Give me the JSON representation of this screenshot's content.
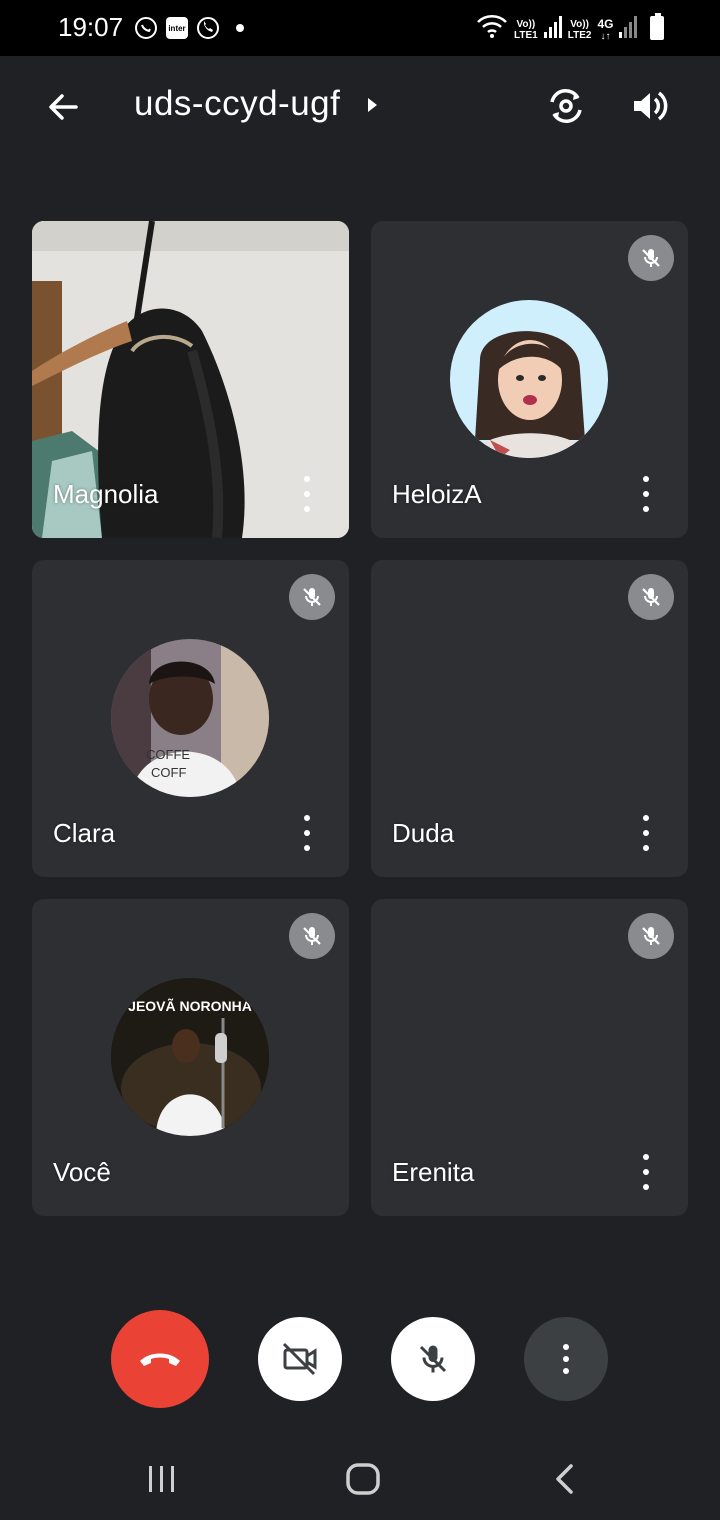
{
  "status_bar": {
    "time": "19:07",
    "notifications": [
      "whatsapp-icon",
      "inter-app-icon",
      "whatsapp-call-icon",
      "dot-icon"
    ],
    "inter_label": "inter",
    "sim1_label_top": "Vo))",
    "sim1_label_bottom": "LTE1",
    "sim2_label_top": "Vo))",
    "sim2_label_bottom": "LTE2",
    "network_label": "4G"
  },
  "header": {
    "meeting_code": "uds-ccyd-ugf"
  },
  "participants": [
    {
      "name": "Magnolia",
      "muted": false,
      "video": true
    },
    {
      "name": "HeloizA",
      "muted": true,
      "video": false
    },
    {
      "name": "Clara",
      "muted": true,
      "video": false
    },
    {
      "name": "Duda",
      "muted": true,
      "video": false
    },
    {
      "name": "Você",
      "muted": true,
      "video": false
    },
    {
      "name": "Erenita",
      "muted": true,
      "video": false
    }
  ],
  "avatar_text": {
    "voce_banner": "JEOVÃ NORONHA"
  },
  "colors": {
    "background": "#202124",
    "tile": "#2e2f33",
    "end_call": "#ea4335",
    "muted_badge": "#8a8b8e"
  },
  "controls": [
    "end-call-button",
    "camera-off-button",
    "mic-off-button",
    "more-options-button"
  ]
}
